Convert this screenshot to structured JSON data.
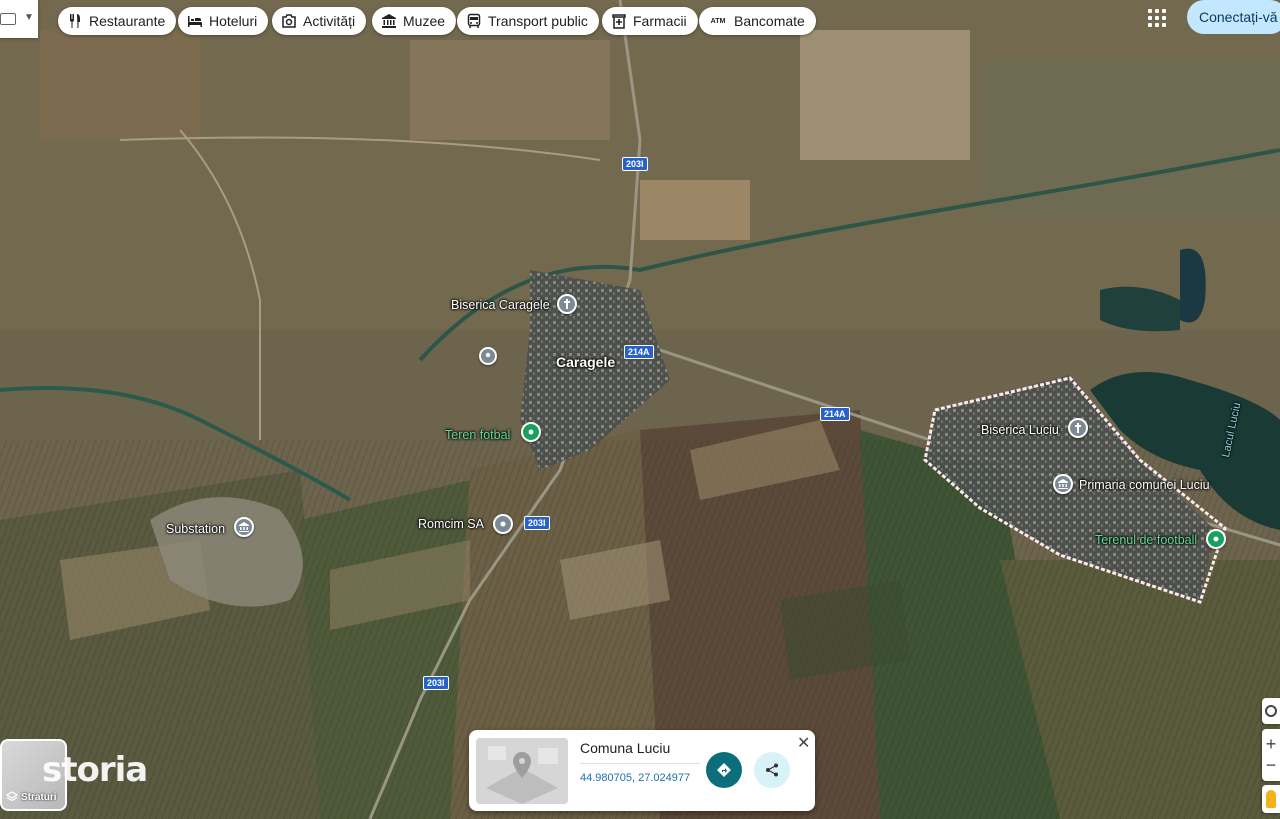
{
  "chips": [
    {
      "label": "Restaurante",
      "icon": "fork-knife-icon"
    },
    {
      "label": "Hoteluri",
      "icon": "bed-icon"
    },
    {
      "label": "Activități",
      "icon": "camera-icon"
    },
    {
      "label": "Muzee",
      "icon": "museum-icon"
    },
    {
      "label": "Transport public",
      "icon": "bus-icon"
    },
    {
      "label": "Farmacii",
      "icon": "pharmacy-icon"
    },
    {
      "label": "Bancomate",
      "icon": "atm-icon"
    }
  ],
  "signin_label": "Conectați-vă",
  "atm_text": "ATM",
  "map": {
    "places": {
      "biserica_caragele": "Biserica Caragele",
      "caragele": "Caragele",
      "teren_fotbal": "Teren fotbal",
      "substation": "Substation",
      "romcim": "Romcim SA",
      "biserica_luciu": "Biserica Luciu",
      "primaria": "Primaria comunei Luciu",
      "terenul": "Terenul de football",
      "lacul": "Lacul Luciu"
    },
    "roads": {
      "r203i_top": "203I",
      "r214a_left": "214A",
      "r214a_right": "214A",
      "r203i_mid": "203I",
      "r203i_bottom": "203I"
    }
  },
  "layers_label": "Straturi",
  "watermark": "storia",
  "card": {
    "name": "Comuna Luciu",
    "coords": "44.980705, 27.024977"
  },
  "controls": {
    "zoom_in": "+",
    "zoom_out": "−"
  },
  "colors": {
    "signin_bg": "#c2e7ff",
    "directions": "#0b6e7a",
    "boundary": "#ffe9ec",
    "green_pin": "#17a05e"
  }
}
